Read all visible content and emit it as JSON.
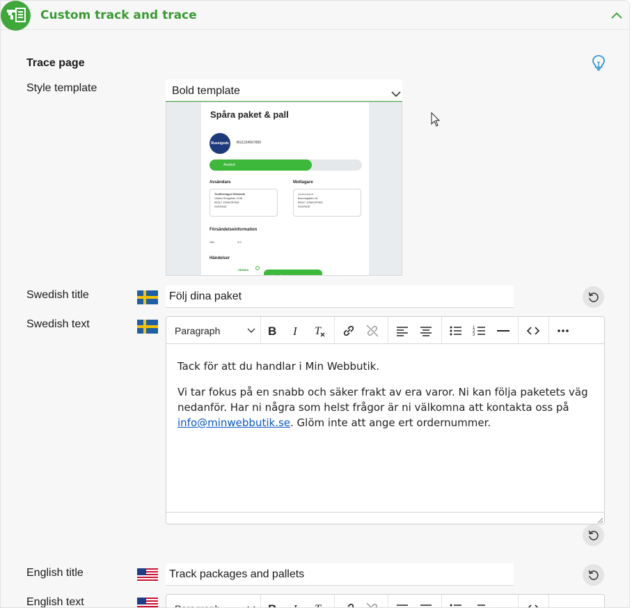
{
  "header": {
    "title": "Custom track and trace"
  },
  "trace_page": {
    "section_title": "Trace page",
    "style_template": {
      "label": "Style template",
      "selected": "Bold template"
    },
    "preview": {
      "title": "Spåra paket & pall",
      "logo_text": "Russigods",
      "tracking_number": "BG1234567890",
      "progress_label": "Avsänd",
      "progress_fraction": 0.67,
      "sender_heading": "Avsändare",
      "sender_lines": [
        "Testföretaget Webbutik",
        "Västra Storgatan 1236",
        "55317 JÖNKÖPING",
        "SVERIGE"
      ],
      "receiver_heading": "Mottagare",
      "receiver_lines": [
        "••••••••••••••••",
        "Brunnsgatan 16",
        "55317 JÖNKÖPING",
        "SVERIGE"
      ],
      "shipment_info_heading": "Försändelseinformation",
      "weight_label": "Vikt",
      "weight_value": "2.0",
      "events_heading": "Händelser",
      "event_label": "HEMMA",
      "event_pill": "Videregående"
    },
    "swedish_title": {
      "label": "Swedish title",
      "value": "Följ dina paket"
    },
    "swedish_text": {
      "label": "Swedish text",
      "paragraph_1": "Tack för att du handlar i Min Webbutik.",
      "paragraph_2_before_link": "Vi tar fokus på en snabb och säker frakt av era varor. Ni kan följa paketets väg nedanför. Har ni några som helst frågor är ni välkomna att kontakta oss på ",
      "link_text": "info@minwebbutik.se",
      "paragraph_2_after_link": ". Glöm inte att ange ert ordernummer."
    },
    "english_title": {
      "label": "English title",
      "value": "Track packages and pallets"
    },
    "english_text": {
      "label": "English text"
    }
  },
  "toolbar": {
    "block_format": "Paragraph"
  },
  "colors": {
    "brand_green": "#3ea83a",
    "link_blue": "#0b57c4"
  }
}
